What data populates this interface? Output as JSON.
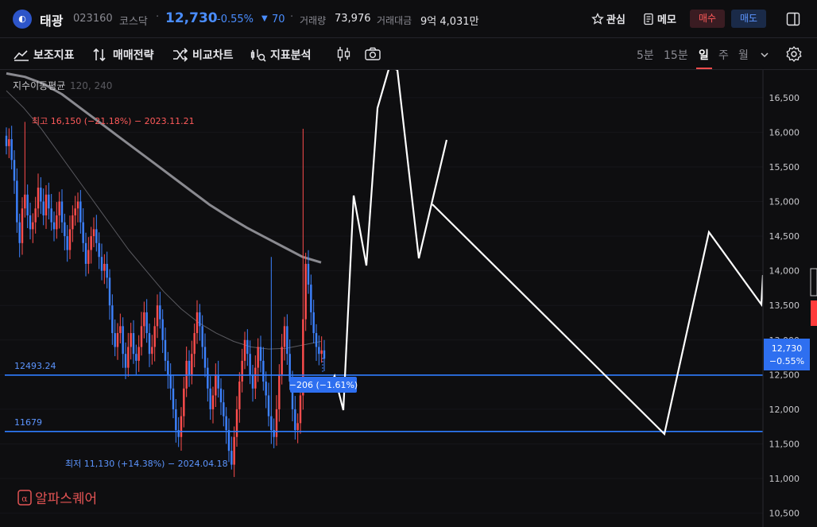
{
  "header": {
    "logo_text": "◐",
    "name": "태광",
    "code": "023160",
    "market": "코스닥",
    "sep": "·",
    "price": "12,730",
    "change_rate": "-0.55%",
    "change_symbol": "▼",
    "change_value": "70",
    "volume_label": "거래량",
    "volume_value": "73,976",
    "amount_label": "거래대금",
    "amount_value": "9억 4,031만",
    "watch_label": "관심",
    "memo_label": "메모",
    "buy_label": "매수",
    "sell_label": "매도",
    "colors": {
      "down": "#4a8dff",
      "up": "#ff5a5a",
      "bg": "#0e0e10"
    }
  },
  "toolbar": {
    "indicators_label": "보조지표",
    "strategy_label": "매매전략",
    "compare_label": "비교차트",
    "analysis_label": "지표분석",
    "timeframes": [
      "5분",
      "15분",
      "일",
      "주",
      "월"
    ],
    "active_timeframe": "일"
  },
  "chart_data": {
    "type": "candlestick",
    "indicator_label": "지수이동평균",
    "indicator_params": "120, 240",
    "y_axis_ticks": [
      10500,
      11000,
      11500,
      12000,
      12500,
      13000,
      13500,
      14000,
      14500,
      15000,
      15500,
      16000,
      16500
    ],
    "y_axis_labels": [
      "10,500",
      "11,000",
      "11,500",
      "12,000",
      "12,500",
      "13,000",
      "13,500",
      "14,000",
      "14,500",
      "15,000",
      "15,500",
      "16,000",
      "16,500"
    ],
    "ylim": [
      10300,
      16900
    ],
    "high_annotation": "최고 16,150 (−21.18%) − 2023.11.21",
    "low_annotation": "최저 11,130 (+14.38%) − 2024.04.18",
    "current_price_label": "12,730",
    "current_rate_label": "−0.55%",
    "current_price": 12730,
    "hlines": [
      {
        "label": "12493.24",
        "value": 12493.24,
        "color": "#2f7dff"
      },
      {
        "label": "11679",
        "value": 11679,
        "color": "#2f7dff"
      }
    ],
    "measure_label": "−206 (−1.61%)",
    "up_color": "#ff4d4d",
    "down_color": "#3d82ff",
    "candles_close": [
      15800,
      15900,
      15600,
      15300,
      14700,
      14400,
      14900,
      15100,
      14800,
      14600,
      14700,
      14900,
      15200,
      15000,
      14800,
      15100,
      14900,
      14700,
      14600,
      14800,
      15000,
      14700,
      14500,
      14300,
      14600,
      14800,
      14900,
      15000,
      14700,
      14400,
      14100,
      14300,
      14500,
      14600,
      14400,
      14200,
      14000,
      14100,
      13900,
      13500,
      13100,
      12900,
      13100,
      13200,
      12800,
      12600,
      12900,
      13100,
      12800,
      12700,
      12900,
      13200,
      13400,
      13100,
      12800,
      12900,
      13200,
      13500,
      13300,
      13000,
      12700,
      12500,
      12300,
      12000,
      11700,
      11600,
      11900,
      12300,
      12700,
      12500,
      12800,
      13100,
      13400,
      13200,
      12900,
      12600,
      12300,
      12000,
      12200,
      12500,
      12300,
      12100,
      11900,
      11700,
      11400,
      11200,
      11600,
      12000,
      12400,
      12700,
      13000,
      12800,
      12500,
      12300,
      12600,
      12900,
      12700,
      12400,
      12200,
      11900,
      11700,
      11600,
      12000,
      12500,
      12900,
      13200,
      12800,
      12400,
      12000,
      11700,
      11800,
      12200,
      13300,
      14100,
      13800,
      13400,
      13100,
      12900,
      12800,
      12850,
      12730
    ],
    "ema120": [
      16600,
      16350,
      16050,
      15700,
      15350,
      15000,
      14650,
      14300,
      14000,
      13700,
      13450,
      13250,
      13100,
      12980,
      12900,
      12870,
      12880,
      12930,
      12980
    ],
    "ema240": [
      16850,
      16800,
      16700,
      16550,
      16350,
      16150,
      15950,
      15750,
      15550,
      15350,
      15150,
      14950,
      14780,
      14620,
      14480,
      14340,
      14200,
      14120
    ],
    "overlay_path": [
      [
        414,
        398
      ],
      [
        421,
        385
      ],
      [
        432,
        428
      ],
      [
        445,
        158
      ],
      [
        461,
        246
      ],
      [
        475,
        48
      ],
      [
        490,
        -4
      ],
      [
        500,
        0
      ],
      [
        527,
        237
      ],
      [
        545,
        160
      ],
      [
        562,
        88
      ]
    ],
    "overlay_path2": [
      [
        544,
        169
      ],
      [
        836,
        458
      ],
      [
        892,
        204
      ],
      [
        958,
        295
      ],
      [
        960,
        258
      ]
    ]
  }
}
